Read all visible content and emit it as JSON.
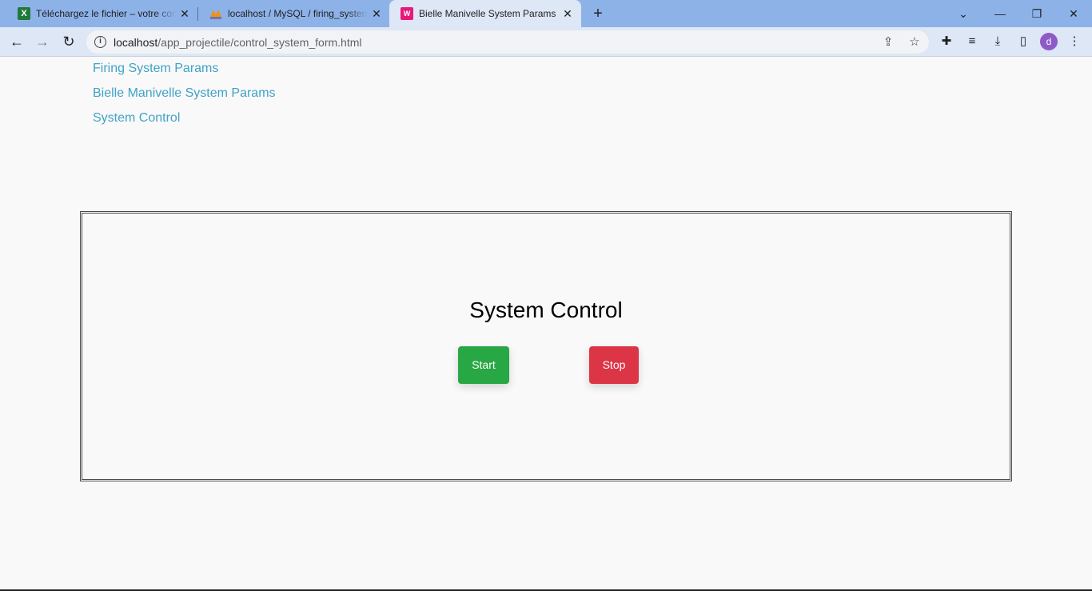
{
  "browser": {
    "tabs": [
      {
        "title": "Téléchargez le fichier – votre con",
        "icon": "excel-icon"
      },
      {
        "title": "localhost / MySQL / firing_system",
        "icon": "phpmyadmin-icon"
      },
      {
        "title": "Bielle Manivelle System Params",
        "icon": "wamp-icon",
        "active": true
      }
    ],
    "url_host": "localhost",
    "url_path": "/app_projectile/control_system_form.html",
    "avatar_letter": "d"
  },
  "nav": {
    "links": [
      "Firing System Params",
      "Bielle Manivelle System Params",
      "System Control"
    ],
    "link_color": "#40a3c7"
  },
  "panel": {
    "title": "System Control",
    "start_label": "Start",
    "stop_label": "Stop",
    "start_color": "#28a745",
    "stop_color": "#dc3545"
  }
}
